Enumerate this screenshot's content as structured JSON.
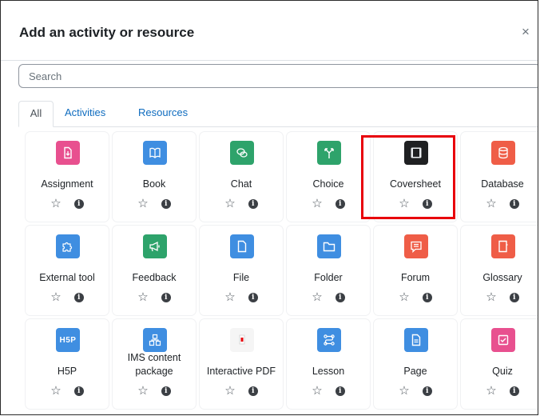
{
  "modal": {
    "title": "Add an activity or resource",
    "close_glyph": "×"
  },
  "search": {
    "placeholder": "Search"
  },
  "tabs": [
    {
      "label": "All",
      "active": true
    },
    {
      "label": "Activities",
      "active": false
    },
    {
      "label": "Resources",
      "active": false
    }
  ],
  "items": [
    {
      "label": "Assignment",
      "icon": "assignment-icon",
      "color": "#e8508f"
    },
    {
      "label": "Book",
      "icon": "book-icon",
      "color": "#3f8ee1"
    },
    {
      "label": "Chat",
      "icon": "chat-icon",
      "color": "#2ea36b"
    },
    {
      "label": "Choice",
      "icon": "choice-icon",
      "color": "#2ea36b"
    },
    {
      "label": "Coversheet",
      "icon": "coversheet-icon",
      "color": "#1f2022"
    },
    {
      "label": "Database",
      "icon": "database-icon",
      "color": "#ef5d47"
    },
    {
      "label": "External tool",
      "icon": "puzzle-icon",
      "color": "#3f8ee1"
    },
    {
      "label": "Feedback",
      "icon": "megaphone-icon",
      "color": "#2ea36b"
    },
    {
      "label": "File",
      "icon": "file-icon",
      "color": "#3f8ee1"
    },
    {
      "label": "Folder",
      "icon": "folder-icon",
      "color": "#3f8ee1"
    },
    {
      "label": "Forum",
      "icon": "forum-icon",
      "color": "#ef5d47"
    },
    {
      "label": "Glossary",
      "icon": "glossary-icon",
      "color": "#ef5d47"
    },
    {
      "label": "H5P",
      "icon": "h5p-icon",
      "color": "#3f8ee1",
      "icon_text": "H5P"
    },
    {
      "label": "IMS content package",
      "icon": "package-icon",
      "color": "#3f8ee1"
    },
    {
      "label": "Interactive PDF",
      "icon": "pdf-icon",
      "color": "#f5f5f5"
    },
    {
      "label": "Lesson",
      "icon": "lesson-icon",
      "color": "#3f8ee1"
    },
    {
      "label": "Page",
      "icon": "page-icon",
      "color": "#3f8ee1"
    },
    {
      "label": "Quiz",
      "icon": "quiz-icon",
      "color": "#e8508f"
    }
  ],
  "highlight": {
    "item": "Coversheet",
    "color": "#e8000b"
  },
  "action_glyphs": {
    "star": "☆",
    "info": "i"
  }
}
